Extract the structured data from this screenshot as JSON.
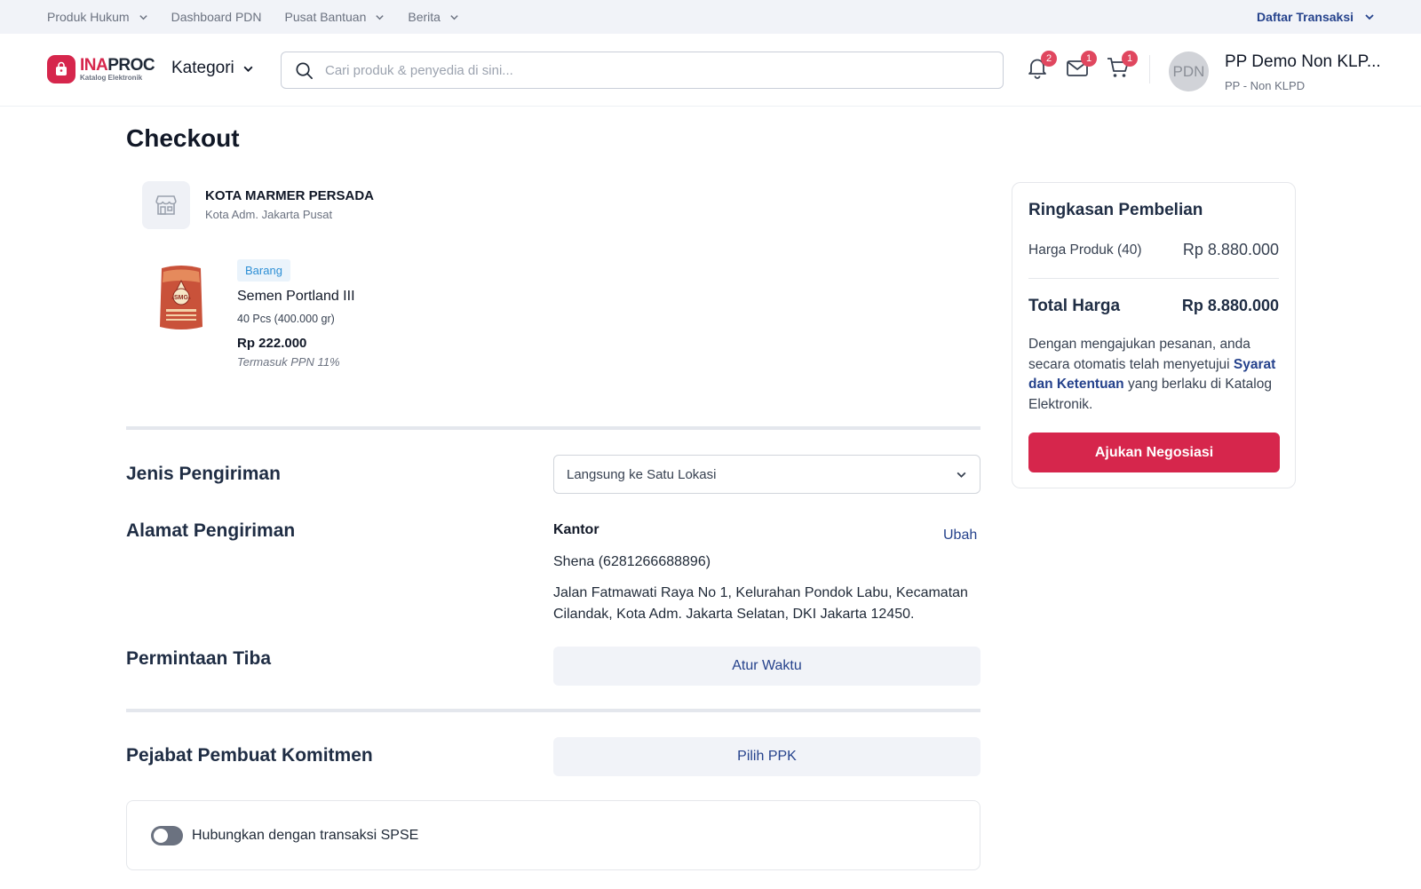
{
  "topbar": {
    "nav": [
      {
        "label": "Produk Hukum",
        "has_dropdown": true
      },
      {
        "label": "Dashboard PDN",
        "has_dropdown": false
      },
      {
        "label": "Pusat Bantuan",
        "has_dropdown": true
      },
      {
        "label": "Berita",
        "has_dropdown": true
      }
    ],
    "daftar_transaksi": "Daftar Transaksi"
  },
  "header": {
    "logo": {
      "ina": "INA",
      "proc": "PROC",
      "sub": "Katalog Elektronik"
    },
    "kategori": "Kategori",
    "search_placeholder": "Cari produk & penyedia di sini...",
    "notifications_count": "2",
    "messages_count": "1",
    "cart_count": "1",
    "avatar_initials": "PDN",
    "user_name": "PP Demo Non KLP...",
    "user_role": "PP - Non KLPD"
  },
  "page": {
    "title": "Checkout",
    "store": {
      "name": "KOTA MARMER PERSADA",
      "city": "Kota Adm. Jakarta Pusat"
    },
    "product": {
      "tag": "Barang",
      "name": "Semen Portland III",
      "qty": "40 Pcs (400.000 gr)",
      "price": "Rp 222.000",
      "tax_note": "Termasuk PPN 11%",
      "bag_text": "SMG"
    },
    "shipping": {
      "label": "Jenis Pengiriman",
      "selected": "Langsung ke Satu Lokasi"
    },
    "address": {
      "label": "Alamat Pengiriman",
      "title": "Kantor",
      "change": "Ubah",
      "contact": "Shena (6281266688896)",
      "line": "Jalan Fatmawati Raya No 1, Kelurahan Pondok Labu, Kecamatan Cilandak, Kota Adm. Jakarta Selatan, DKI Jakarta 12450."
    },
    "arrival": {
      "label": "Permintaan Tiba",
      "button": "Atur Waktu"
    },
    "ppk": {
      "label": "Pejabat Pembuat Komitmen",
      "button": "Pilih PPK"
    },
    "spse": {
      "label": "Hubungkan dengan transaksi SPSE",
      "enabled": false
    }
  },
  "summary": {
    "title": "Ringkasan Pembelian",
    "product_label": "Harga Produk (40)",
    "product_value": "Rp 8.880.000",
    "total_label": "Total Harga",
    "total_value": "Rp 8.880.000",
    "note_before": "Dengan mengajukan pesanan, anda secara otomatis telah menyetujui ",
    "note_link": "Syarat dan Ketentuan",
    "note_after": " yang berlaku di Katalog Elektronik.",
    "cta": "Ajukan Negosiasi"
  },
  "colors": {
    "brand": "#d6264c",
    "link": "#25428c",
    "tag": "#2d8fd5"
  }
}
